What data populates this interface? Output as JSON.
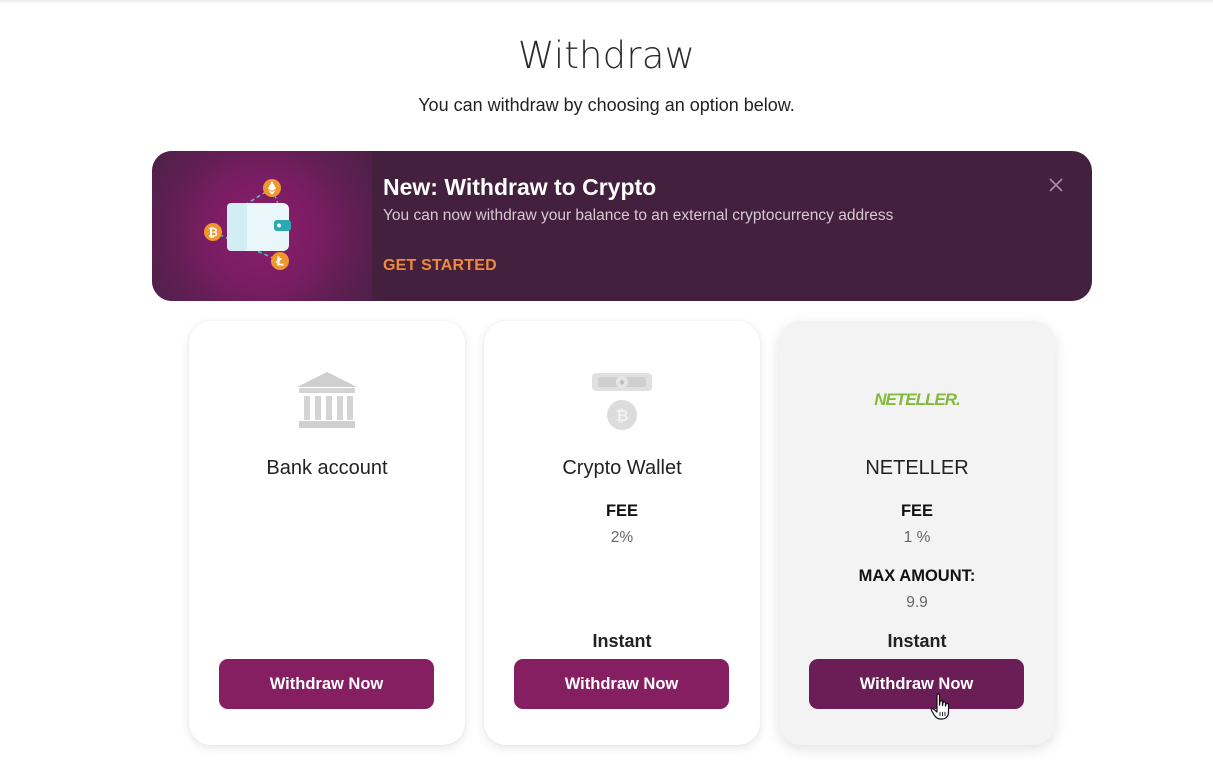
{
  "page": {
    "title": "Withdraw",
    "subtitle": "You can withdraw by choosing an option below."
  },
  "banner": {
    "title": "New: Withdraw to Crypto",
    "text": "You can now withdraw your balance to an external cryptocurrency address",
    "cta": "GET STARTED",
    "close_icon": "close-icon",
    "illustration_icons": [
      "wallet-icon",
      "ethereum-coin-icon",
      "bitcoin-coin-icon",
      "litecoin-coin-icon"
    ]
  },
  "cards": [
    {
      "name": "Bank account",
      "icon": "bank-icon",
      "button": "Withdraw Now"
    },
    {
      "name": "Crypto Wallet",
      "icon": "crypto-wallet-icon",
      "fee_label": "FEE",
      "fee_value": "2%",
      "speed": "Instant",
      "button": "Withdraw Now"
    },
    {
      "name": "NETELLER",
      "logo_text": "NETELLER.",
      "fee_label": "FEE",
      "fee_value": "1 %",
      "max_label": "MAX AMOUNT:",
      "max_value": "9.9",
      "speed": "Instant",
      "button": "Withdraw Now"
    }
  ],
  "colors": {
    "banner_bg": "#44203f",
    "brand_button": "#861e62",
    "cta_orange": "#f08a3a",
    "neteller_green": "#83ba3b",
    "coin_orange": "#f0962e"
  }
}
